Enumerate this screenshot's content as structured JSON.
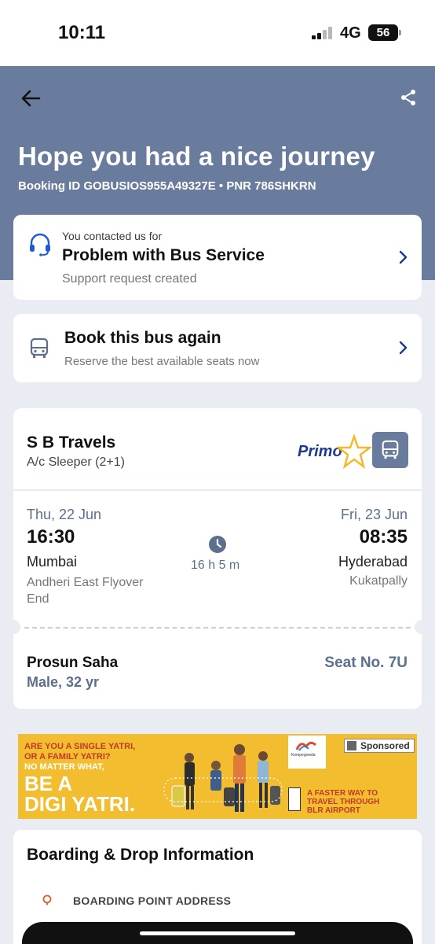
{
  "status_bar": {
    "time": "10:11",
    "network": "4G",
    "battery": "56"
  },
  "header": {
    "title": "Hope you had a nice journey",
    "booking_line": "Booking ID GOBUSIOS955A49327E • PNR 786SHKRN"
  },
  "support": {
    "subtitle": "You contacted us for",
    "title": "Problem with Bus Service",
    "status": "Support request created"
  },
  "rebook": {
    "title": "Book this bus again",
    "subtitle": "Reserve the best available seats now"
  },
  "ticket": {
    "operator": "S B Travels",
    "bus_type": "A/c Sleeper (2+1)",
    "badge": "Primo",
    "departure": {
      "date": "Thu, 22 Jun",
      "time": "16:30",
      "city": "Mumbai",
      "point": "Andheri East Flyover End"
    },
    "arrival": {
      "date": "Fri, 23 Jun",
      "time": "08:35",
      "city": "Hyderabad",
      "point": "Kukatpally"
    },
    "duration": "16 h 5 m",
    "passenger": {
      "name": "Prosun Saha",
      "meta": "Male, 32 yr",
      "seat": "Seat No. 7U"
    }
  },
  "ad": {
    "line1": "ARE YOU A SINGLE YATRI,",
    "line2": "OR A FAMILY YATRI?",
    "line3": "NO MATTER WHAT,",
    "headline1": "BE A",
    "headline2": "DIGI YATRI.",
    "tag1": "A FASTER WAY TO",
    "tag2": "TRAVEL THROUGH",
    "tag3": "BLR AIRPORT",
    "logo_text": "Kempegowda",
    "sponsored": "Sponsored"
  },
  "boarding": {
    "title": "Boarding & Drop Information",
    "label": "BOARDING POINT ADDRESS"
  },
  "colors": {
    "header_bg": "#6a7c9d",
    "accent_blue": "#1f5bd8",
    "muted_blue": "#5c6f8c",
    "ad_yellow": "#f2bd2e"
  }
}
